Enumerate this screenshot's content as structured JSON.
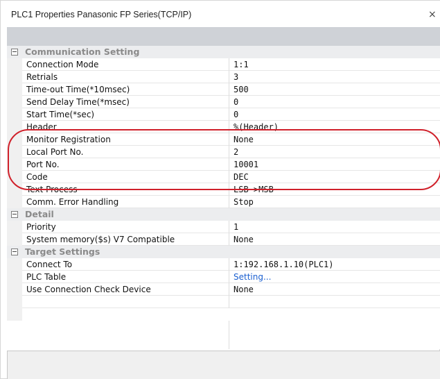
{
  "window": {
    "title": "PLC1 Properties Panasonic FP Series(TCP/IP)",
    "close_symbol": "×"
  },
  "sections": [
    {
      "label": "Communication Setting",
      "rows": [
        {
          "name": "Connection Mode",
          "value": "1:1"
        },
        {
          "name": "Retrials",
          "value": "3"
        },
        {
          "name": "Time-out Time(*10msec)",
          "value": "500"
        },
        {
          "name": "Send Delay Time(*msec)",
          "value": "0"
        },
        {
          "name": "Start Time(*sec)",
          "value": "0"
        },
        {
          "name": "Header",
          "value": "%(Header)"
        },
        {
          "name": "Monitor Registration",
          "value": "None"
        },
        {
          "name": "Local Port No.",
          "value": "2"
        },
        {
          "name": "Port No.",
          "value": "10001"
        },
        {
          "name": "Code",
          "value": "DEC"
        },
        {
          "name": "Text Process",
          "value": "LSB->MSB"
        },
        {
          "name": "Comm. Error Handling",
          "value": "Stop"
        }
      ]
    },
    {
      "label": "Detail",
      "rows": [
        {
          "name": "Priority",
          "value": "1"
        },
        {
          "name": "System memory($s) V7 Compatible",
          "value": "None"
        }
      ]
    },
    {
      "label": "Target Settings",
      "rows": [
        {
          "name": "Connect To",
          "value": "1:192.168.1.10(PLC1)"
        },
        {
          "name": "PLC Table",
          "value": "Setting..."
        },
        {
          "name": "Use Connection Check Device",
          "value": "None"
        }
      ]
    }
  ],
  "colors": {
    "highlight": "#d0202a",
    "link": "#1a5fd0",
    "toolbar": "#cfd2d7"
  }
}
